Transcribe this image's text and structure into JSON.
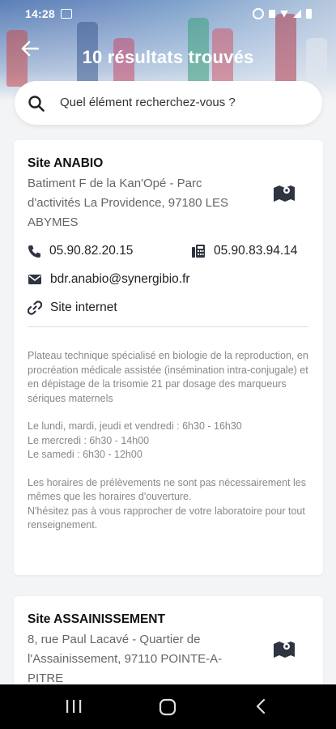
{
  "status_bar": {
    "time": "14:28"
  },
  "header": {
    "title": "10 résultats trouvés"
  },
  "search": {
    "placeholder": "Quel élément recherchez-vous ?"
  },
  "results": [
    {
      "name": "Site ANABIO",
      "address": "Batiment F de la Kan'Opé - Parc d'activités La Providence, 97180  LES ABYMES",
      "phone": "05.90.82.20.15",
      "fax": "05.90.83.94.14",
      "email": "bdr.anabio@synergibio.fr",
      "website": "Site internet",
      "description": [
        "Plateau technique spécialisé en biologie de la reproduction, en procréation médicale assistée (insémination intra-conjugale) et en dépistage de la trisomie 21 par dosage des marqueurs sériques maternels",
        "Le lundi, mardi, jeudi et vendredi : 6h30 - 16h30\nLe mercredi : 6h30 - 14h00\nLe samedi : 6h30 - 12h00",
        "Les horaires de prélèvements ne sont pas nécessairement les mêmes que les horaires d'ouverture.\nN'hésitez pas à vous rapprocher de votre laboratoire pour tout renseignement."
      ]
    },
    {
      "name": "Site ASSAINISSEMENT",
      "address": "8, rue Paul Lacavé -  Quartier de l'Assainissement, 97110 POINTE-A-PITRE"
    }
  ],
  "colors": {
    "header_blue": "#6f8fc2",
    "icon_dark": "#2e3440",
    "text_gray": "#666666"
  }
}
